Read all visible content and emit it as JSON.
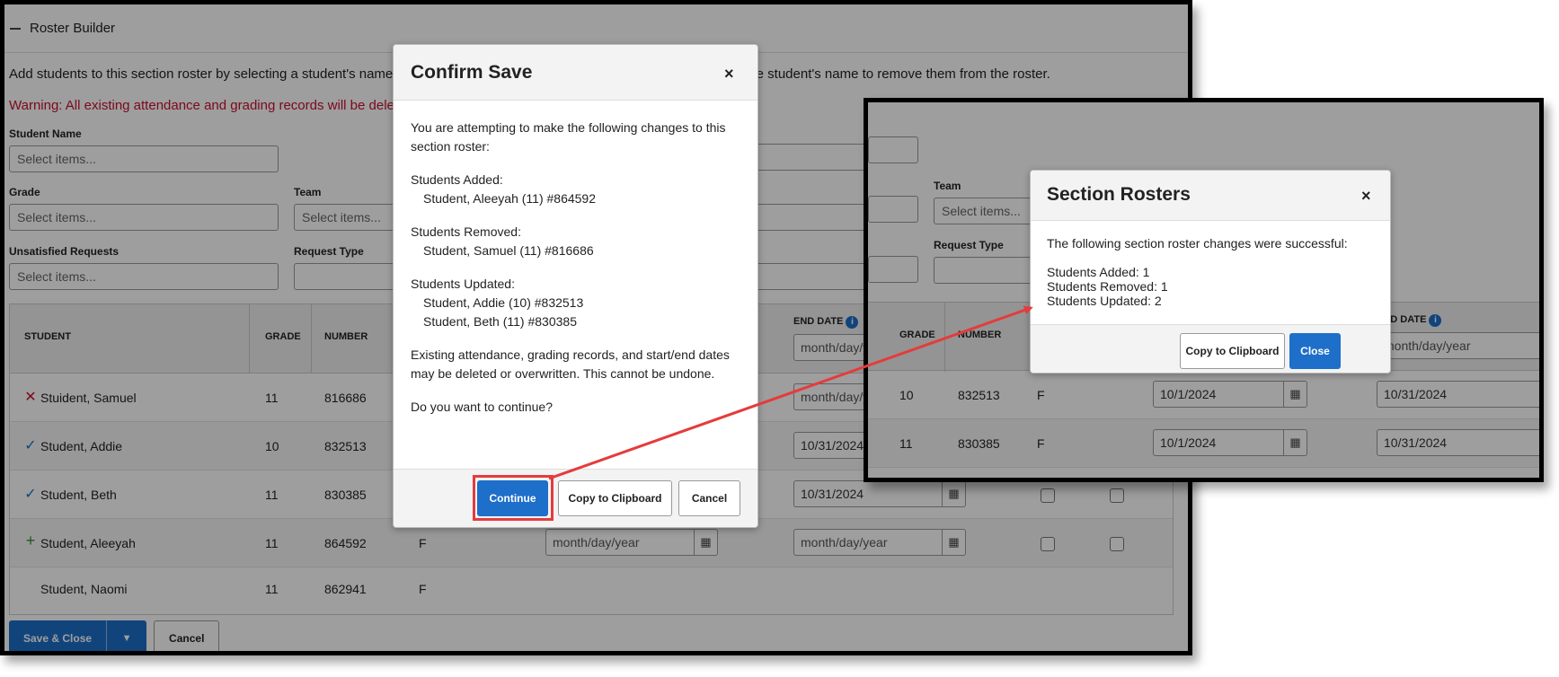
{
  "section": {
    "title": "Roster Builder",
    "instructions": "Add students to this section roster by selecting a student's name from the list. Students are added when selected. Unselect the student's name to remove them from the roster.",
    "warning": "Warning: All existing attendance and grading records will be deleted if a student is removed from the roster."
  },
  "filters": {
    "student_name": {
      "label": "Student Name",
      "placeholder": "Select items..."
    },
    "grade": {
      "label": "Grade",
      "placeholder": "Select items..."
    },
    "team": {
      "label": "Team",
      "placeholder": "Select items..."
    },
    "unsatisfied": {
      "label": "Unsatisfied Requests",
      "placeholder": "Select items..."
    },
    "request_type": {
      "label": "Request Type",
      "placeholder": ""
    }
  },
  "table": {
    "columns": {
      "student": "STUDENT",
      "grade": "GRADE",
      "number": "NUMBER",
      "end_date": "END DATE"
    },
    "date_placeholder": "month/day/year",
    "rows": [
      {
        "name": "Stuident, Samuel",
        "grade": "11",
        "number": "816686",
        "gender": "",
        "end": "month/day/year"
      },
      {
        "name": "Student, Addie",
        "grade": "10",
        "number": "832513",
        "gender": "",
        "end": "10/31/2024"
      },
      {
        "name": "Student, Beth",
        "grade": "11",
        "number": "830385",
        "gender": "",
        "end": "10/31/2024"
      },
      {
        "name": "Student, Aleeyah",
        "grade": "11",
        "number": "864592",
        "gender": "F",
        "start": "month/day/year",
        "end": "month/day/year"
      },
      {
        "name": "Student, Naomi",
        "grade": "11",
        "number": "862941",
        "gender": "F"
      }
    ]
  },
  "footer": {
    "save_close": "Save & Close",
    "cancel": "Cancel"
  },
  "confirm_modal": {
    "title": "Confirm Save",
    "close_glyph": "×",
    "intro": "You are attempting to make the following changes to this section roster:",
    "added_label": "Students Added:",
    "added": [
      "Student, Aleeyah (11) #864592"
    ],
    "removed_label": "Students Removed:",
    "removed": [
      "Student, Samuel (11) #816686"
    ],
    "updated_label": "Students Updated:",
    "updated": [
      "Student, Addie (10) #832513",
      "Student, Beth (11) #830385"
    ],
    "warning": "Existing attendance, grading records, and start/end dates may be deleted or overwritten.  This cannot be undone.",
    "question": "Do you want to continue?",
    "continue": "Continue",
    "copy": "Copy to Clipboard",
    "cancel": "Cancel"
  },
  "inset": {
    "filters": {
      "team_label": "Team",
      "team_placeholder": "Select items...",
      "request_type_label": "Request Type"
    },
    "columns": {
      "grade": "GRADE",
      "number": "NUMBER",
      "end_date": "END DATE"
    },
    "rows": [
      {
        "grade": "10",
        "number": "832513",
        "gender": "F",
        "start": "10/1/2024",
        "end": "10/31/2024"
      },
      {
        "grade": "11",
        "number": "830385",
        "gender": "F",
        "start": "10/1/2024",
        "end": "10/31/2024"
      }
    ],
    "end_placeholder": "month/day/year",
    "modal": {
      "title": "Section Rosters",
      "close_glyph": "×",
      "message": "The following section roster changes were successful:",
      "added": "Students Added: 1",
      "removed": "Students Removed: 1",
      "updated": "Students Updated: 2",
      "copy": "Copy to Clipboard",
      "close": "Close"
    }
  },
  "colors": {
    "primary": "#1e6fc9",
    "warning": "#c8102e",
    "highlight": "#e53b3b"
  }
}
